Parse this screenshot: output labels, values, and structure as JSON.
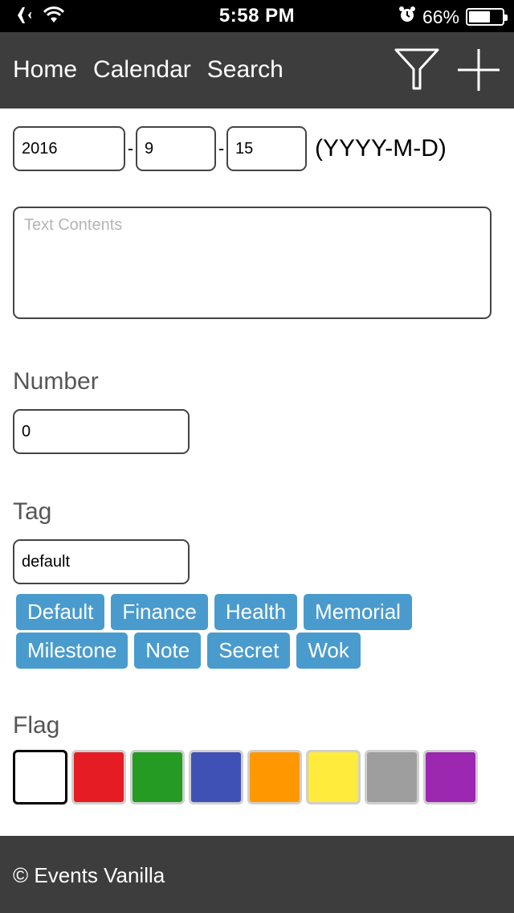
{
  "status_bar": {
    "time": "5:58 PM",
    "battery_percent": "66%",
    "battery_level": 0.66,
    "icons": [
      "airplane-icon",
      "wifi-icon",
      "alarm-icon",
      "battery-icon"
    ]
  },
  "navbar": {
    "links": [
      "Home",
      "Calendar",
      "Search"
    ],
    "icons": [
      "filter-icon",
      "plus-icon"
    ]
  },
  "form": {
    "date": {
      "year": "2016",
      "month": "9",
      "day": "15",
      "separator": "-",
      "format_hint": "(YYYY-M-D)"
    },
    "text_contents": {
      "value": "",
      "placeholder": "Text Contents"
    },
    "number": {
      "label": "Number",
      "value": "0"
    },
    "tag": {
      "label": "Tag",
      "value": "default",
      "options": [
        "Default",
        "Finance",
        "Health",
        "Memorial",
        "Milestone",
        "Note",
        "Secret",
        "Wok"
      ]
    },
    "flag": {
      "label": "Flag",
      "selected": "#ffffff",
      "colors": [
        "#ffffff",
        "#e51c23",
        "#259b24",
        "#3f51b5",
        "#ff9800",
        "#ffeb3b",
        "#9e9e9e",
        "#9c27b0"
      ]
    }
  },
  "colors": {
    "bar_background": "#3d3d3d",
    "chip_background": "#4a9bcd"
  },
  "footer": {
    "text": "© Events Vanilla"
  }
}
